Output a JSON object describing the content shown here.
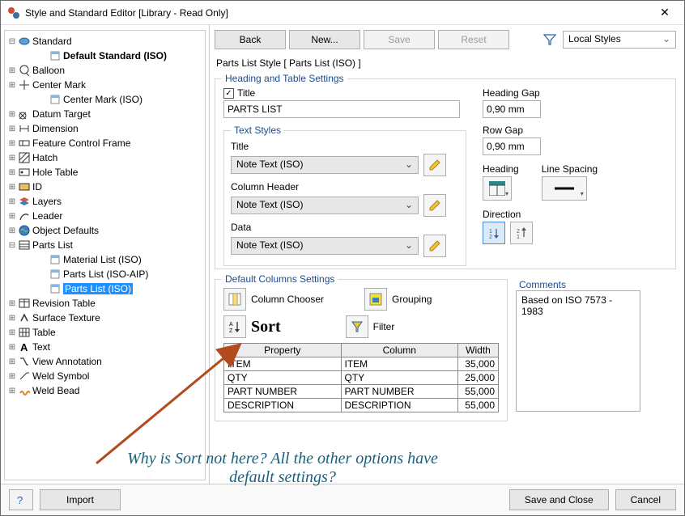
{
  "window": {
    "title": "Style and Standard Editor [Library - Read Only]"
  },
  "toolbar": {
    "back": "Back",
    "new": "New...",
    "save": "Save",
    "reset": "Reset",
    "styles_scope": "Local Styles"
  },
  "path_label": "Parts List Style [ Parts List (ISO) ]",
  "tree": [
    {
      "tw": "−",
      "lvl": 0,
      "icon": "standard",
      "label": "Standard",
      "bold": false
    },
    {
      "tw": "",
      "lvl": 1,
      "icon": "doc",
      "label": "Default Standard (ISO)",
      "bold": true
    },
    {
      "tw": "+",
      "lvl": 0,
      "icon": "balloon",
      "label": "Balloon"
    },
    {
      "tw": "+",
      "lvl": 0,
      "icon": "centermark",
      "label": "Center Mark"
    },
    {
      "tw": "",
      "lvl": 1,
      "icon": "doc",
      "label": "Center Mark (ISO)"
    },
    {
      "tw": "+",
      "lvl": 0,
      "icon": "datum",
      "label": "Datum Target"
    },
    {
      "tw": "+",
      "lvl": 0,
      "icon": "dimension",
      "label": "Dimension"
    },
    {
      "tw": "+",
      "lvl": 0,
      "icon": "fcf",
      "label": "Feature Control Frame"
    },
    {
      "tw": "+",
      "lvl": 0,
      "icon": "hatch",
      "label": "Hatch"
    },
    {
      "tw": "+",
      "lvl": 0,
      "icon": "holetable",
      "label": "Hole Table"
    },
    {
      "tw": "+",
      "lvl": 0,
      "icon": "id",
      "label": "ID"
    },
    {
      "tw": "+",
      "lvl": 0,
      "icon": "layers",
      "label": "Layers"
    },
    {
      "tw": "+",
      "lvl": 0,
      "icon": "leader",
      "label": "Leader"
    },
    {
      "tw": "+",
      "lvl": 0,
      "icon": "objdef",
      "label": "Object Defaults"
    },
    {
      "tw": "−",
      "lvl": 0,
      "icon": "partslist",
      "label": "Parts List"
    },
    {
      "tw": "",
      "lvl": 1,
      "icon": "doc",
      "label": "Material List (ISO)"
    },
    {
      "tw": "",
      "lvl": 1,
      "icon": "doc",
      "label": "Parts List (ISO-AIP)"
    },
    {
      "tw": "",
      "lvl": 1,
      "icon": "doc",
      "label": "Parts List (ISO)",
      "sel": true
    },
    {
      "tw": "+",
      "lvl": 0,
      "icon": "revtable",
      "label": "Revision Table"
    },
    {
      "tw": "+",
      "lvl": 0,
      "icon": "surftex",
      "label": "Surface Texture"
    },
    {
      "tw": "+",
      "lvl": 0,
      "icon": "table",
      "label": "Table"
    },
    {
      "tw": "+",
      "lvl": 0,
      "icon": "text",
      "label": "Text"
    },
    {
      "tw": "+",
      "lvl": 0,
      "icon": "viewann",
      "label": "View Annotation"
    },
    {
      "tw": "+",
      "lvl": 0,
      "icon": "weldsym",
      "label": "Weld Symbol"
    },
    {
      "tw": "+",
      "lvl": 0,
      "icon": "weldbead",
      "label": "Weld Bead"
    }
  ],
  "heading": {
    "group": "Heading and Table Settings",
    "title_chk_label": "Title",
    "title_value": "PARTS LIST",
    "text_styles": "Text Styles",
    "ts_title": "Title",
    "ts_title_val": "Note Text (ISO)",
    "ts_colhead": "Column Header",
    "ts_colhead_val": "Note Text (ISO)",
    "ts_data": "Data",
    "ts_data_val": "Note Text (ISO)",
    "hgap_lbl": "Heading Gap",
    "hgap_val": "0,90 mm",
    "rgap_lbl": "Row Gap",
    "rgap_val": "0,90 mm",
    "heading_lbl": "Heading",
    "linesp_lbl": "Line Spacing",
    "direction_lbl": "Direction"
  },
  "defcols": {
    "group": "Default Columns Settings",
    "col_chooser": "Column Chooser",
    "grouping": "Grouping",
    "filter": "Filter",
    "headers": {
      "property": "Property",
      "column": "Column",
      "width": "Width"
    },
    "rows": [
      {
        "p": "ITEM",
        "c": "ITEM",
        "w": "35,000"
      },
      {
        "p": "QTY",
        "c": "QTY",
        "w": "25,000"
      },
      {
        "p": "PART NUMBER",
        "c": "PART NUMBER",
        "w": "55,000"
      },
      {
        "p": "DESCRIPTION",
        "c": "DESCRIPTION",
        "w": "55,000"
      }
    ],
    "comments_lbl": "Comments",
    "comments_val": "Based on ISO 7573 - 1983"
  },
  "footer": {
    "import": "Import",
    "save_close": "Save and Close",
    "cancel": "Cancel"
  },
  "annotation": {
    "sort": "Sort",
    "text": "Why is Sort not here? All the other options have default settings?"
  }
}
